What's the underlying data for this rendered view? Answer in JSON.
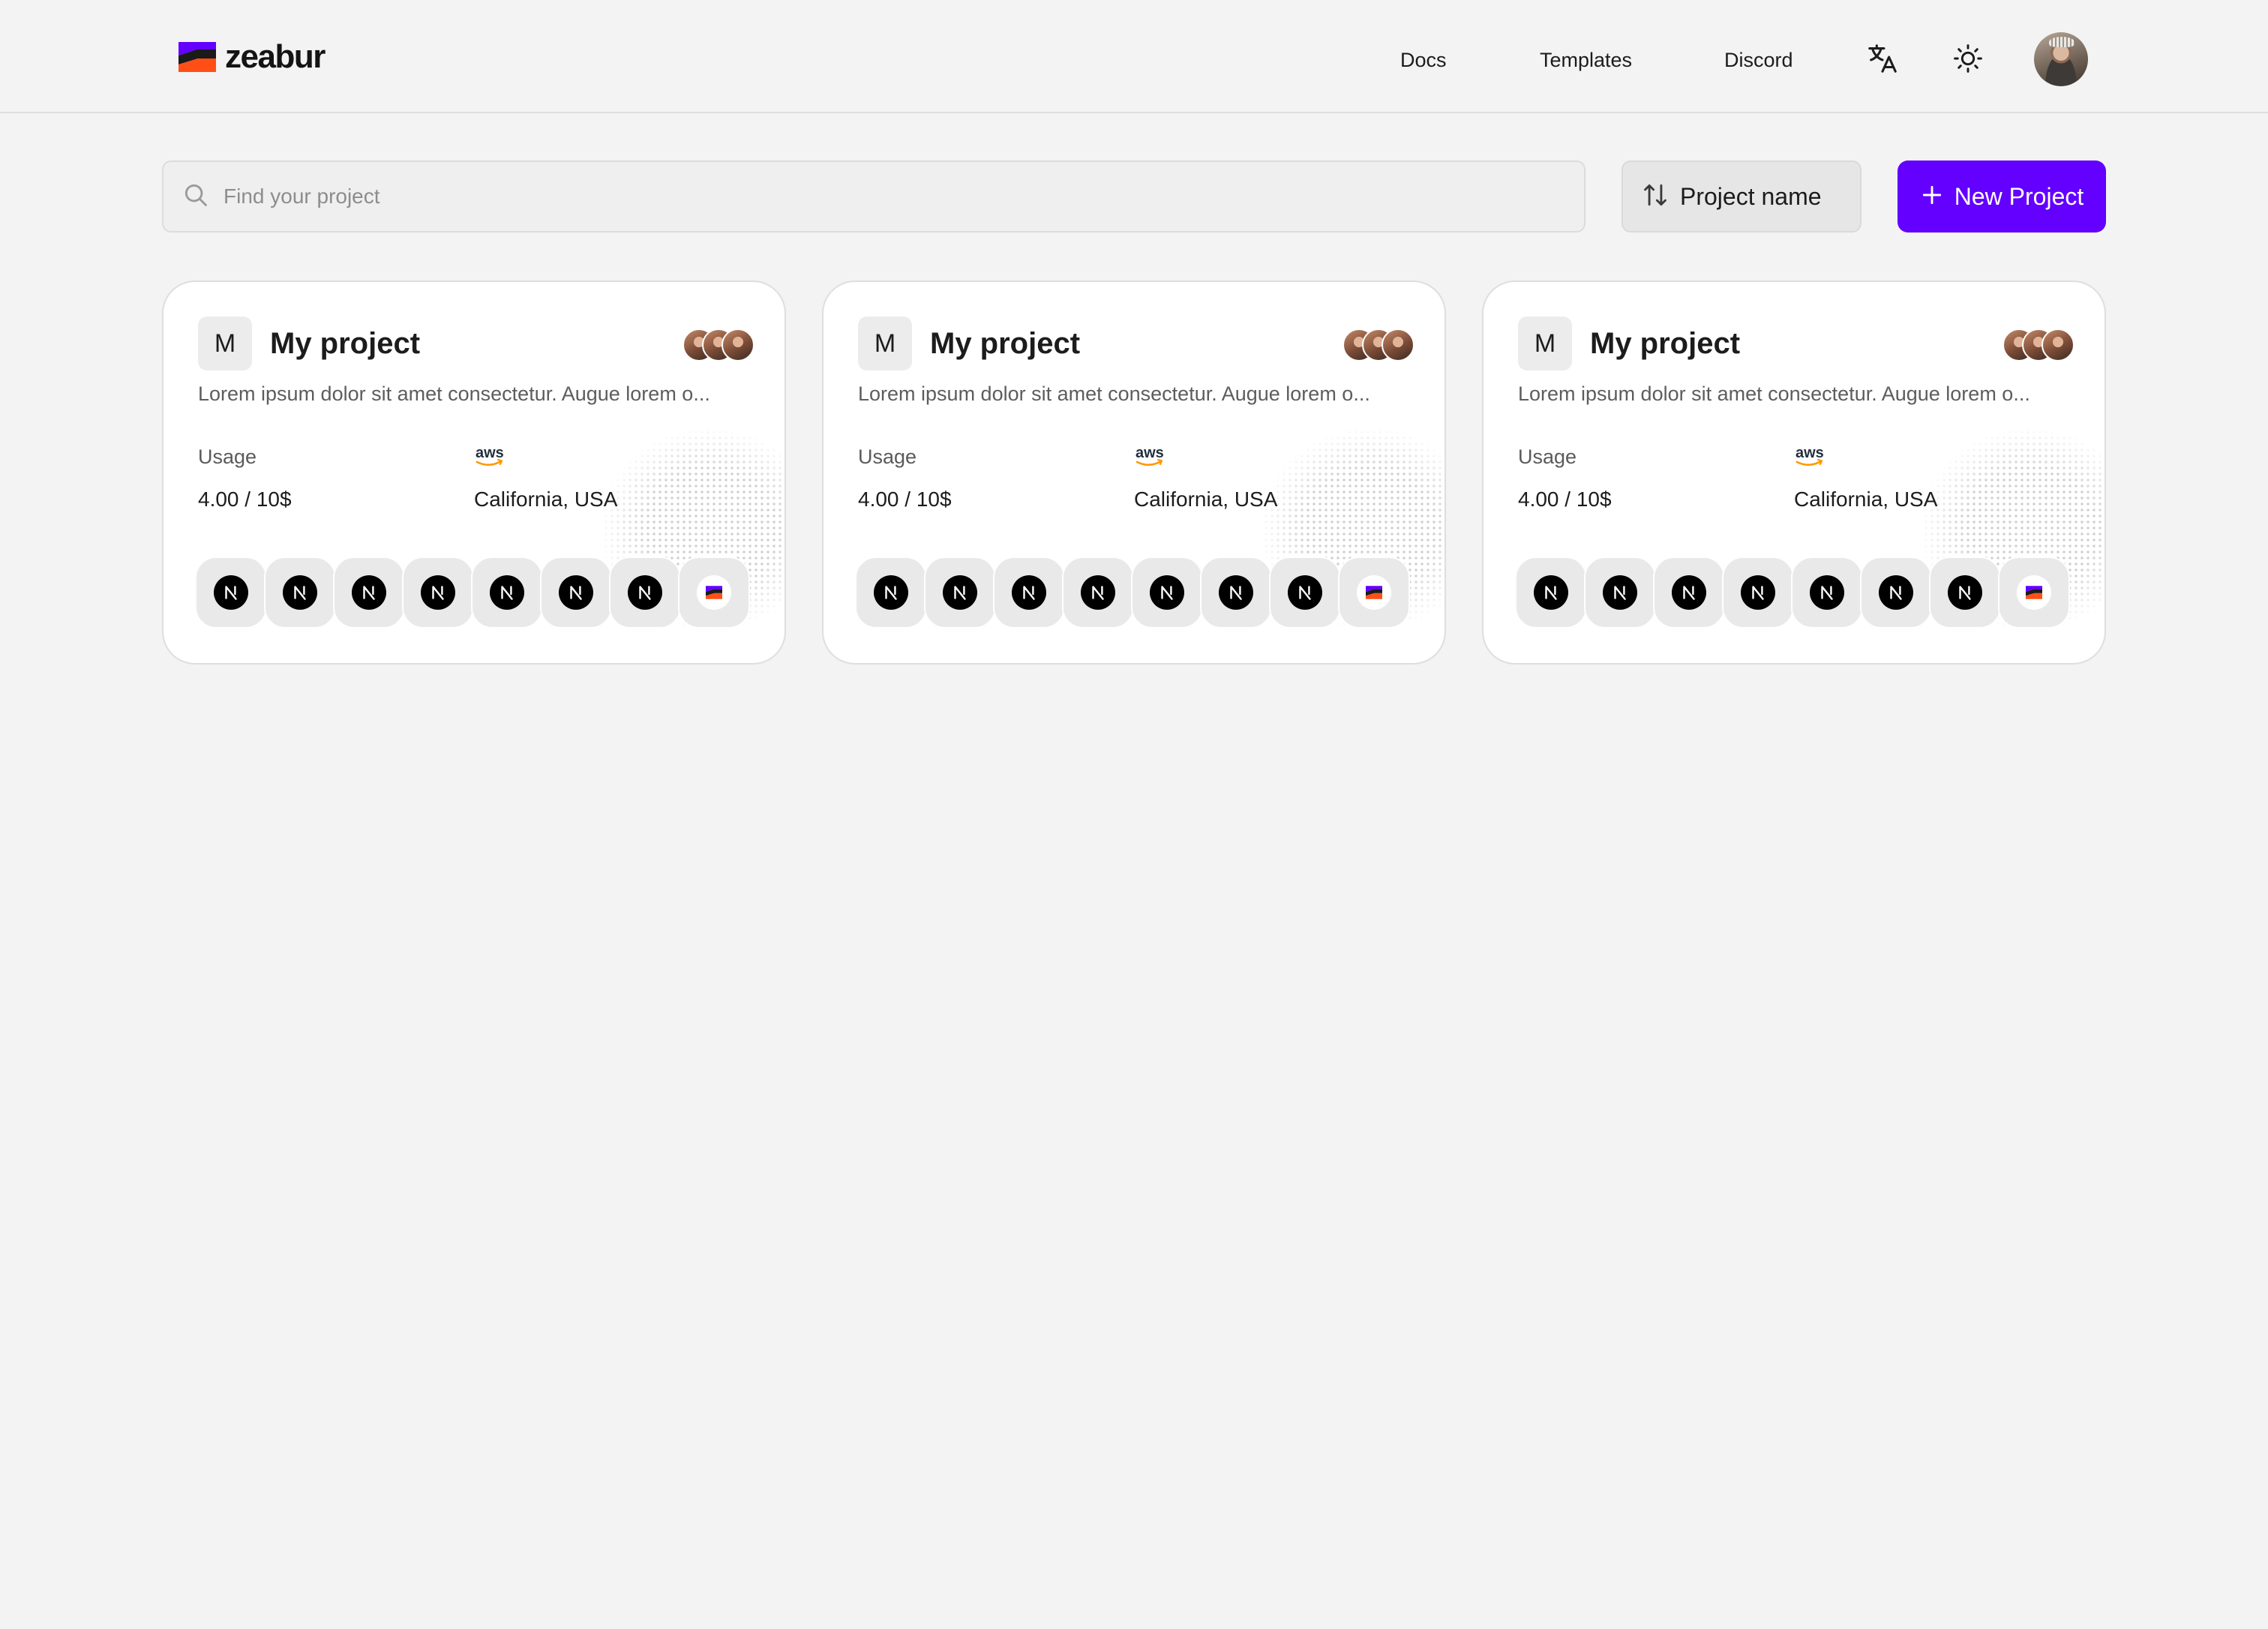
{
  "header": {
    "brand": "zeabur",
    "nav": [
      "Docs",
      "Templates",
      "Discord"
    ]
  },
  "toolbar": {
    "search_placeholder": "Find your project",
    "sort_label": "Project name",
    "new_project_label": "New Project"
  },
  "colors": {
    "accent": "#6300ff",
    "background": "#f3f3f3",
    "card": "#ffffff",
    "brand_purple": "#6300ff",
    "brand_orange": "#ff4f17"
  },
  "projects": [
    {
      "initial": "M",
      "name": "My project",
      "description": "Lorem ipsum dolor sit amet consectetur. Augue lorem o...",
      "usage_label": "Usage",
      "usage_value": "4.00 / 10$",
      "provider": "aws",
      "region": "California, USA",
      "services": [
        "nextjs-icon",
        "nextjs-icon",
        "nextjs-icon",
        "nextjs-icon",
        "nextjs-icon",
        "nextjs-icon",
        "nextjs-icon",
        "zeabur-icon"
      ]
    },
    {
      "initial": "M",
      "name": "My project",
      "description": "Lorem ipsum dolor sit amet consectetur. Augue lorem o...",
      "usage_label": "Usage",
      "usage_value": "4.00 / 10$",
      "provider": "aws",
      "region": "California, USA",
      "services": [
        "nextjs-icon",
        "nextjs-icon",
        "nextjs-icon",
        "nextjs-icon",
        "nextjs-icon",
        "nextjs-icon",
        "nextjs-icon",
        "zeabur-icon"
      ]
    },
    {
      "initial": "M",
      "name": "My project",
      "description": "Lorem ipsum dolor sit amet consectetur. Augue lorem o...",
      "usage_label": "Usage",
      "usage_value": "4.00 / 10$",
      "provider": "aws",
      "region": "California, USA",
      "services": [
        "nextjs-icon",
        "nextjs-icon",
        "nextjs-icon",
        "nextjs-icon",
        "nextjs-icon",
        "nextjs-icon",
        "nextjs-icon",
        "zeabur-icon"
      ]
    }
  ]
}
